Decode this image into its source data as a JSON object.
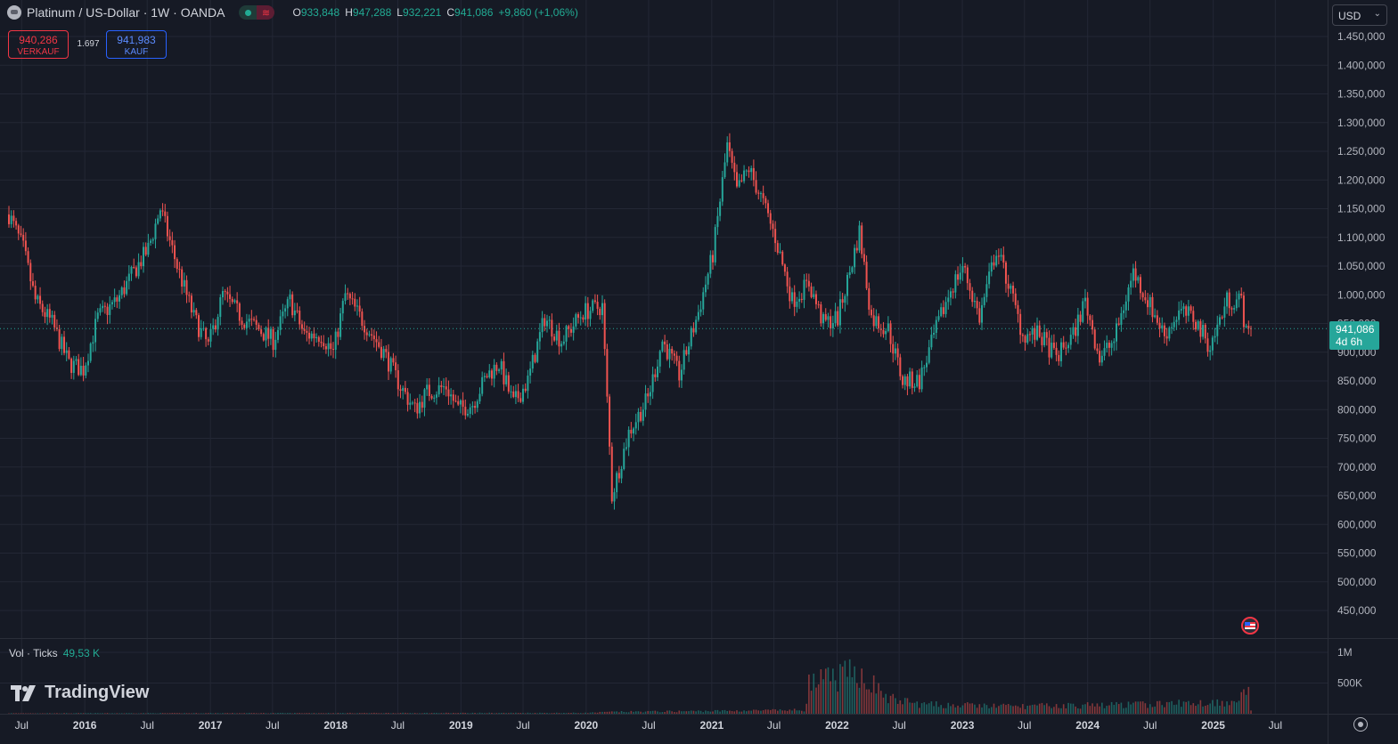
{
  "legend": {
    "title": "Platinum / US-Dollar · 1W · OANDA",
    "wave_glyph": "≋",
    "ohlc": {
      "o_key": "O",
      "o": "933,848",
      "h_key": "H",
      "h": "947,288",
      "l_key": "L",
      "l": "932,221",
      "c_key": "C",
      "c": "941,086",
      "change": "+9,860 (+1,06%)"
    }
  },
  "trade": {
    "sell_price": "940,286",
    "sell_label": "VERKAUF",
    "spread": "1.697",
    "buy_price": "941,983",
    "buy_label": "KAUF"
  },
  "currency": {
    "value": "USD",
    "chevron": "⌄"
  },
  "price_tag": {
    "price": "941,086",
    "countdown": "4d 6h"
  },
  "volume": {
    "label": "Vol · Ticks",
    "value": "49,53 K"
  },
  "branding": {
    "logo_text": "TradingView"
  },
  "colors": {
    "up": "#26a69a",
    "down": "#ef5350",
    "background": "#161a25",
    "grid": "#232735",
    "text": "#b2b5be"
  },
  "chart_data": {
    "type": "candlestick",
    "interval": "1W",
    "x_range": [
      "2015-05",
      "2025-07"
    ],
    "ylim": [
      425,
      1475
    ],
    "price_ticks": [
      "1.450,000",
      "1.400,000",
      "1.350,000",
      "1.300,000",
      "1.250,000",
      "1.200,000",
      "1.150,000",
      "1.100,000",
      "1.050,000",
      "1.000,000",
      "950,000",
      "900,000",
      "850,000",
      "800,000",
      "750,000",
      "700,000",
      "650,000",
      "600,000",
      "550,000",
      "500,000",
      "450,000"
    ],
    "price_tick_values": [
      1450,
      1400,
      1350,
      1300,
      1250,
      1200,
      1150,
      1100,
      1050,
      1000,
      950,
      900,
      850,
      800,
      750,
      700,
      650,
      600,
      550,
      500,
      450
    ],
    "volume_ticks": [
      "1M",
      "500K"
    ],
    "volume_tick_values": [
      1000000,
      500000
    ],
    "time_ticks": [
      "Jul",
      "2016",
      "Jul",
      "2017",
      "Jul",
      "2018",
      "Jul",
      "2019",
      "Jul",
      "2020",
      "Jul",
      "2021",
      "Jul",
      "2022",
      "Jul",
      "2023",
      "Jul",
      "2024",
      "Jul",
      "2025",
      "Jul"
    ],
    "time_tick_dates": [
      "2015-07",
      "2016-01",
      "2016-07",
      "2017-01",
      "2017-07",
      "2018-01",
      "2018-07",
      "2019-01",
      "2019-07",
      "2020-01",
      "2020-07",
      "2021-01",
      "2021-07",
      "2022-01",
      "2022-07",
      "2023-01",
      "2023-07",
      "2024-01",
      "2024-07",
      "2025-01",
      "2025-07"
    ],
    "grid": true,
    "last_price": 941.086,
    "close_path": [
      [
        "2015-05-25",
        1140
      ],
      [
        "2015-07-06",
        1080
      ],
      [
        "2015-08-10",
        990
      ],
      [
        "2015-09-28",
        950
      ],
      [
        "2015-11-16",
        880
      ],
      [
        "2015-12-28",
        870
      ],
      [
        "2016-02-08",
        960
      ],
      [
        "2016-04-04",
        990
      ],
      [
        "2016-05-23",
        1040
      ],
      [
        "2016-07-04",
        1080
      ],
      [
        "2016-08-08",
        1150
      ],
      [
        "2016-09-26",
        1050
      ],
      [
        "2016-11-14",
        960
      ],
      [
        "2016-12-26",
        910
      ],
      [
        "2017-02-06",
        1000
      ],
      [
        "2017-04-03",
        960
      ],
      [
        "2017-05-22",
        940
      ],
      [
        "2017-07-03",
        920
      ],
      [
        "2017-08-21",
        990
      ],
      [
        "2017-10-02",
        930
      ],
      [
        "2017-11-20",
        930
      ],
      [
        "2017-12-25",
        900
      ],
      [
        "2018-01-29",
        1000
      ],
      [
        "2018-03-26",
        950
      ],
      [
        "2018-05-21",
        900
      ],
      [
        "2018-07-09",
        840
      ],
      [
        "2018-08-20",
        800
      ],
      [
        "2018-09-24",
        830
      ],
      [
        "2018-11-19",
        840
      ],
      [
        "2018-12-24",
        800
      ],
      [
        "2019-02-04",
        810
      ],
      [
        "2019-03-18",
        860
      ],
      [
        "2019-04-22",
        880
      ],
      [
        "2019-06-03",
        810
      ],
      [
        "2019-07-15",
        850
      ],
      [
        "2019-09-02",
        960
      ],
      [
        "2019-10-21",
        920
      ],
      [
        "2019-12-23",
        970
      ],
      [
        "2020-02-17",
        980
      ],
      [
        "2020-03-16",
        650
      ],
      [
        "2020-05-04",
        760
      ],
      [
        "2020-06-29",
        820
      ],
      [
        "2020-08-10",
        920
      ],
      [
        "2020-09-28",
        860
      ],
      [
        "2020-11-23",
        970
      ],
      [
        "2021-01-04",
        1070
      ],
      [
        "2021-02-15",
        1260
      ],
      [
        "2021-03-15",
        1180
      ],
      [
        "2021-04-19",
        1220
      ],
      [
        "2021-05-24",
        1170
      ],
      [
        "2021-07-05",
        1100
      ],
      [
        "2021-08-23",
        990
      ],
      [
        "2021-10-11",
        1020
      ],
      [
        "2021-11-22",
        950
      ],
      [
        "2022-01-03",
        960
      ],
      [
        "2022-02-07",
        1040
      ],
      [
        "2022-03-07",
        1110
      ],
      [
        "2022-04-11",
        960
      ],
      [
        "2022-05-30",
        940
      ],
      [
        "2022-07-11",
        850
      ],
      [
        "2022-08-29",
        850
      ],
      [
        "2022-10-17",
        940
      ],
      [
        "2022-11-28",
        1010
      ],
      [
        "2023-01-02",
        1050
      ],
      [
        "2023-02-20",
        960
      ],
      [
        "2023-04-10",
        1080
      ],
      [
        "2023-05-15",
        1020
      ],
      [
        "2023-06-26",
        930
      ],
      [
        "2023-08-14",
        930
      ],
      [
        "2023-10-02",
        890
      ],
      [
        "2023-11-20",
        930
      ],
      [
        "2023-12-25",
        990
      ],
      [
        "2024-02-05",
        890
      ],
      [
        "2024-03-18",
        920
      ],
      [
        "2024-05-13",
        1040
      ],
      [
        "2024-06-24",
        990
      ],
      [
        "2024-08-12",
        930
      ],
      [
        "2024-09-23",
        970
      ],
      [
        "2024-11-04",
        960
      ],
      [
        "2024-12-23",
        910
      ],
      [
        "2025-02-10",
        990
      ],
      [
        "2025-03-24",
        990
      ],
      [
        "2025-04-07",
        930
      ],
      [
        "2025-04-21",
        941
      ]
    ],
    "volume_profile": [
      [
        "2015-05-25",
        8000
      ],
      [
        "2019-12-30",
        14000
      ],
      [
        "2020-03-16",
        30000
      ],
      [
        "2021-01-04",
        45000
      ],
      [
        "2021-09-27",
        60000
      ],
      [
        "2021-10-11",
        480000
      ],
      [
        "2022-03-07",
        680000
      ],
      [
        "2022-05-30",
        250000
      ],
      [
        "2022-09-05",
        150000
      ],
      [
        "2023-06-05",
        120000
      ],
      [
        "2024-06-03",
        150000
      ],
      [
        "2025-02-10",
        190000
      ],
      [
        "2025-04-07",
        330000
      ],
      [
        "2025-04-14",
        450000
      ],
      [
        "2025-04-21",
        49530
      ]
    ]
  }
}
